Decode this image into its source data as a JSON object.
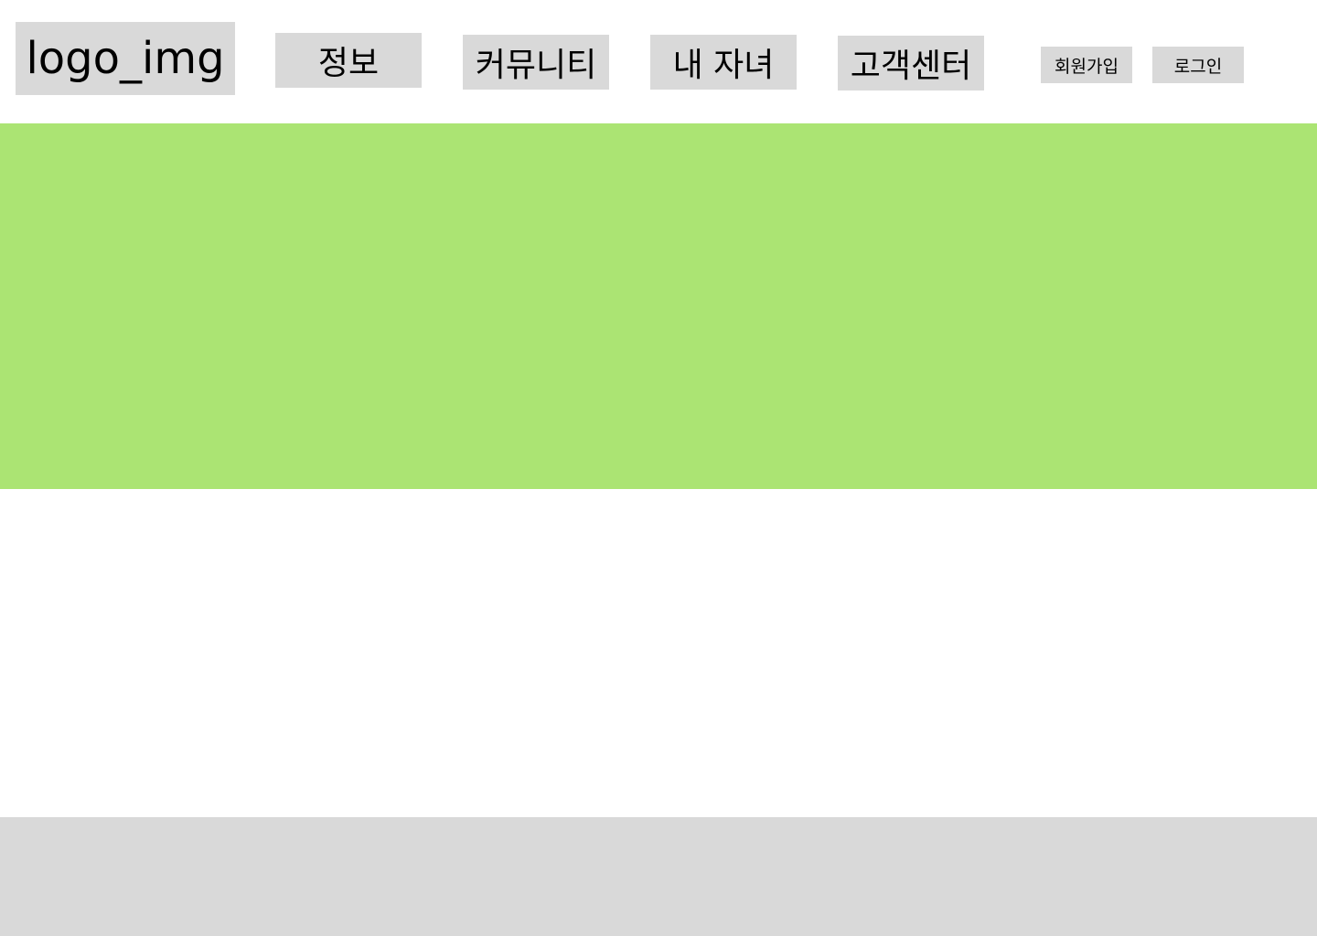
{
  "header": {
    "logo_label": "logo_img",
    "nav": {
      "info": "정보",
      "community": "커뮤니티",
      "my_children": "내 자녀",
      "support": "고객센터"
    },
    "auth": {
      "signup": "회원가입",
      "login": "로그인"
    }
  },
  "colors": {
    "placeholder_gray": "#d9d9d9",
    "hero_green": "#abe473",
    "background": "#ffffff"
  }
}
